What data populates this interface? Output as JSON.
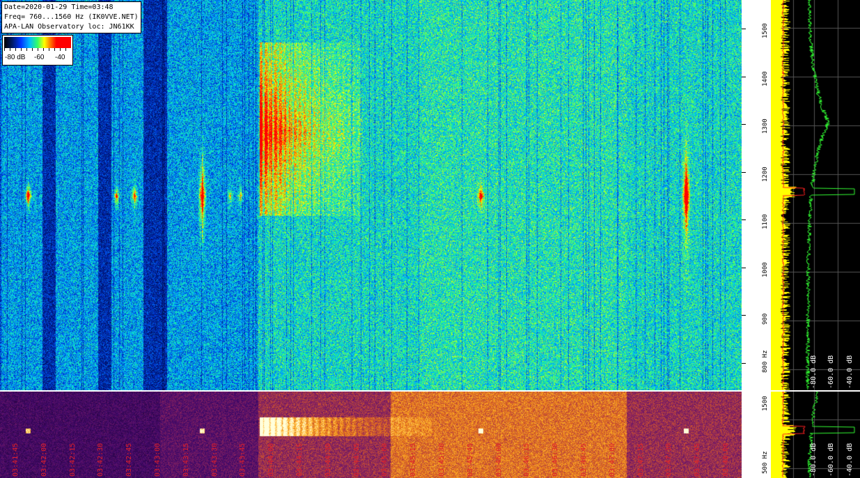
{
  "info": {
    "line1": "Date=2020-01-29 Time=03:48",
    "line2": "Freq= 760...1560 Hz (IK0VVE.NET)",
    "line3": "APA-LAN Observatory loc: JN61KK"
  },
  "scale": {
    "label_left": "-80 dB",
    "label_mid": "-60",
    "label_right": "-40"
  },
  "freq_axis": {
    "ticks": [
      "1500",
      "1400",
      "1300",
      "1200",
      "1100",
      "1000",
      "900",
      "800 Hz"
    ],
    "values": [
      1500,
      1400,
      1300,
      1200,
      1100,
      1000,
      900,
      800
    ]
  },
  "freq_axis_lower": {
    "ticks": [
      "1500",
      "500 Hz"
    ]
  },
  "spectrum": {
    "db_labels": [
      "-80.0 dB",
      "-60.0 dB",
      "-40.0 dB"
    ],
    "db_labels_lower": [
      "-80.0 dB",
      "-60.0 dB",
      "-40.0 dB"
    ]
  },
  "timeline": {
    "labels": [
      "03:41:45",
      "03:42:00",
      "03:42:15",
      "03:42:30",
      "03:42:45",
      "03:43:00",
      "03:43:15",
      "03:43:30",
      "03:43:45",
      "03:44:00",
      "03:44:15",
      "03:44:30",
      "03:44:45",
      "03:45:00",
      "03:45:15",
      "03:45:30",
      "03:45:45",
      "03:46:00",
      "03:46:15",
      "03:46:30",
      "03:46:45",
      "03:47:00",
      "03:47:15",
      "03:47:30",
      "03:47:45",
      "03:48:00"
    ]
  },
  "colors": {
    "waterfall_bg": "#0a1f5c",
    "spectrum_yellow": "#ffff00",
    "spectrum_green": "#33ff33",
    "spectrum_red": "#ff2020",
    "time_label": "#e0202a"
  }
}
